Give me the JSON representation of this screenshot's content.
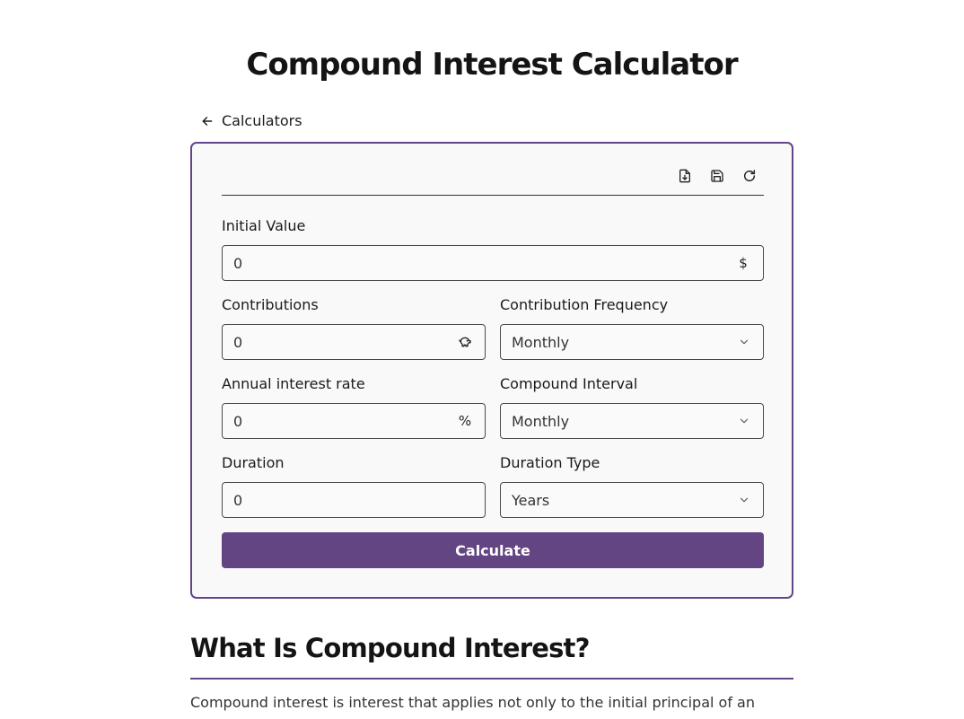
{
  "page": {
    "title": "Compound Interest Calculator",
    "back_link": "Calculators"
  },
  "toolbar": {
    "icons": [
      "file-download-icon",
      "save-icon",
      "reset-icon"
    ]
  },
  "form": {
    "initial_value": {
      "label": "Initial Value",
      "value": "0",
      "suffix": "$"
    },
    "contributions": {
      "label": "Contributions",
      "value": "0",
      "suffix_icon": "piggy-bank-icon"
    },
    "contribution_frequency": {
      "label": "Contribution Frequency",
      "selected": "Monthly"
    },
    "annual_interest_rate": {
      "label": "Annual interest rate",
      "value": "0",
      "suffix": "%"
    },
    "compound_interval": {
      "label": "Compound Interval",
      "selected": "Monthly"
    },
    "duration": {
      "label": "Duration",
      "value": "0"
    },
    "duration_type": {
      "label": "Duration Type",
      "selected": "Years"
    },
    "calculate_label": "Calculate"
  },
  "article": {
    "heading": "What Is Compound Interest?",
    "intro": "Compound interest is interest that applies not only to the initial principal of an"
  },
  "colors": {
    "accent": "#634583",
    "card_border": "#64448a"
  }
}
